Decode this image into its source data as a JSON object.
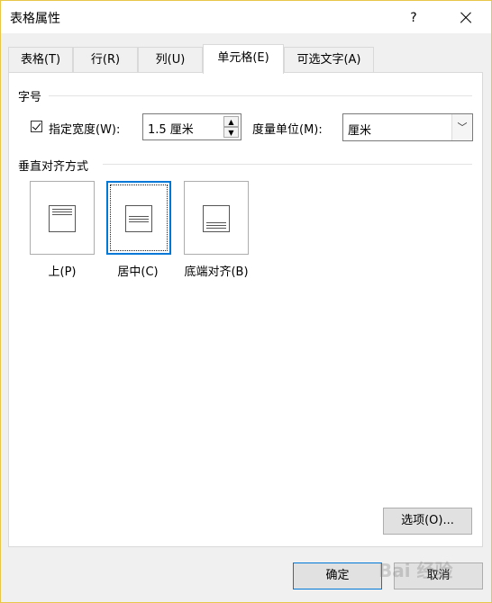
{
  "window": {
    "title": "表格属性",
    "help_label": "?"
  },
  "tabs": [
    {
      "label": "表格(T)",
      "active": false
    },
    {
      "label": "行(R)",
      "active": false
    },
    {
      "label": "列(U)",
      "active": false
    },
    {
      "label": "单元格(E)",
      "active": true
    },
    {
      "label": "可选文字(A)",
      "active": false
    }
  ],
  "size_section": {
    "heading": "字号",
    "width_checkbox_label": "指定宽度(W):",
    "width_checked": true,
    "width_value": "1.5 厘米",
    "measure_label": "度量单位(M):",
    "measure_value": "厘米"
  },
  "valign_section": {
    "heading": "垂直对齐方式",
    "options": [
      {
        "label": "上(P)",
        "selected": false
      },
      {
        "label": "居中(C)",
        "selected": true
      },
      {
        "label": "底端对齐(B)",
        "selected": false
      }
    ]
  },
  "buttons": {
    "options": "选项(O)...",
    "ok": "确定",
    "cancel": "取消"
  },
  "watermark_text": "Bai 经验"
}
